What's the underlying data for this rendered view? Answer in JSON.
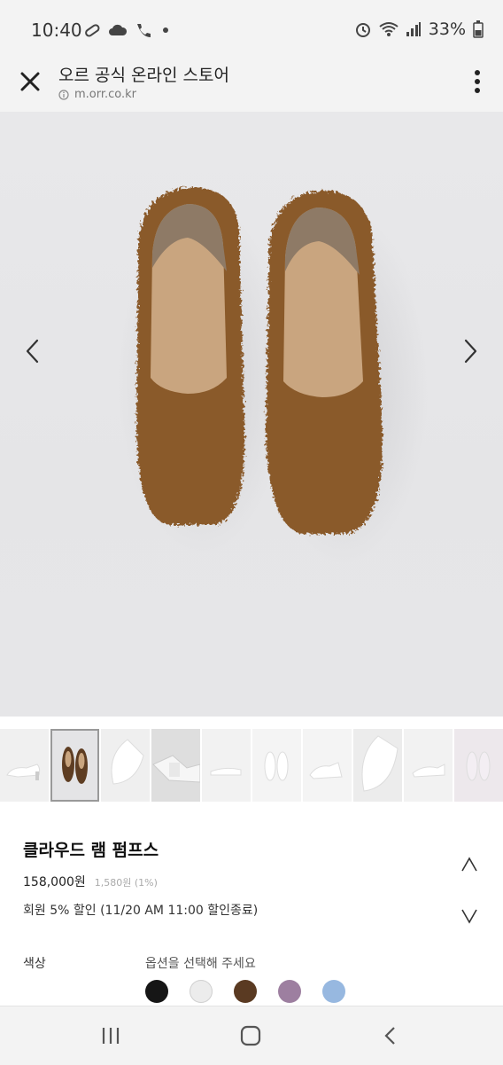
{
  "status_bar": {
    "time": "10:40",
    "battery": "33%",
    "left_icons": [
      "pill-icon",
      "cloud-icon",
      "wifi-call-icon",
      "dot-icon"
    ],
    "right_icons": [
      "alarm-icon",
      "wifi-icon",
      "signal-icon",
      "battery-icon"
    ]
  },
  "browser": {
    "title": "오르 공식 온라인 스토어",
    "url": "m.orr.co.kr"
  },
  "product": {
    "name": "클라우드 램 펌프스",
    "price": "158,000원",
    "points": "1,580원 (1%)",
    "discount": "회원 5% 할인 (11/20 AM 11:00 할인종료)",
    "image_colors": {
      "shoe_outer": "#8a5a2c",
      "shoe_inner": "#c9a57f",
      "background": "#e6e6e8"
    }
  },
  "options": {
    "color_label": "색상",
    "prompt": "옵션을 선택해 주세요",
    "swatches": [
      {
        "color": "#161616"
      },
      {
        "color": "#ececec"
      },
      {
        "color": "#5a3a22"
      },
      {
        "color": "#9d7fa0"
      },
      {
        "color": "#97b8e0"
      }
    ]
  },
  "thumbnails": [
    {
      "tone": "#f0f0f0",
      "shoe": "#ffffff"
    },
    {
      "tone": "#e4e4e6",
      "shoe": "#5e3d22"
    },
    {
      "tone": "#efefef",
      "shoe": "#ffffff"
    },
    {
      "tone": "#dedede",
      "shoe": "#f6f6f6"
    },
    {
      "tone": "#f2f2f2",
      "shoe": "#ffffff"
    },
    {
      "tone": "#f4f4f4",
      "shoe": "#ffffff"
    },
    {
      "tone": "#f4f4f4",
      "shoe": "#ffffff"
    },
    {
      "tone": "#ececec",
      "shoe": "#ffffff"
    },
    {
      "tone": "#f2f2f2",
      "shoe": "#ffffff"
    },
    {
      "tone": "#ede8ec",
      "shoe": "#f3eef3"
    }
  ]
}
